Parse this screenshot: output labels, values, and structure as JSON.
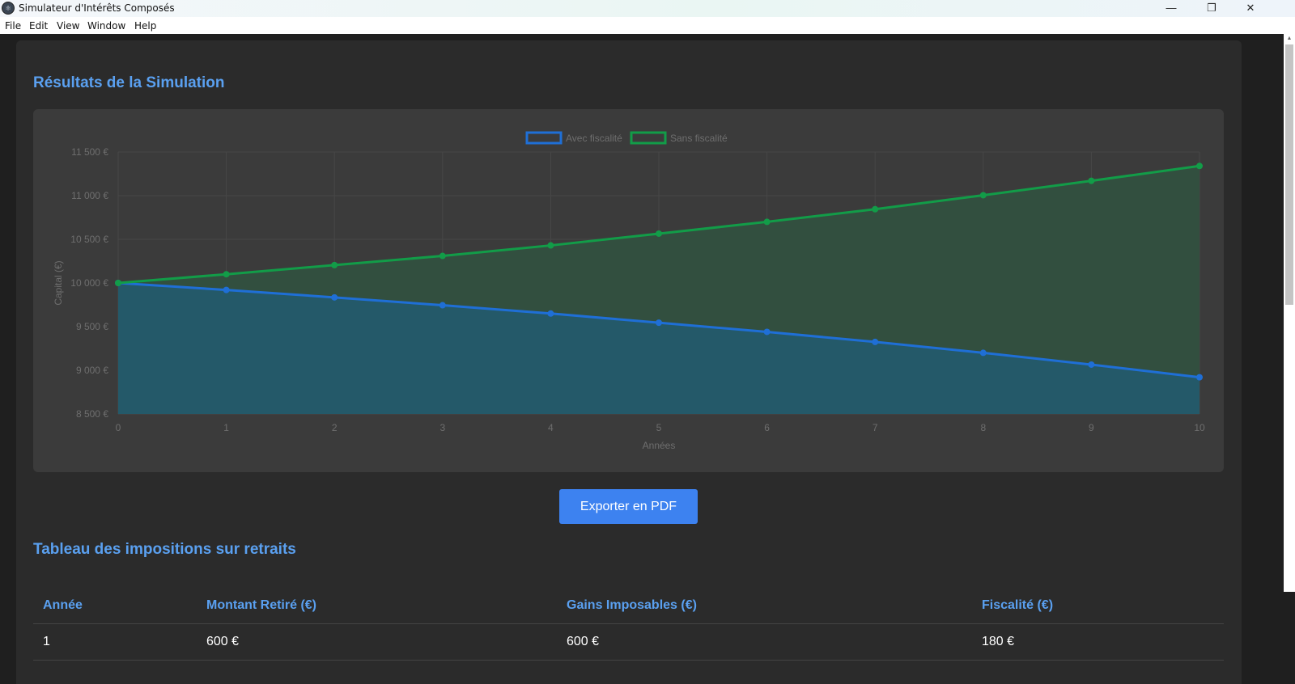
{
  "window": {
    "title": "Simulateur d'Intérêts Composés",
    "minimize": "—",
    "restore": "❐",
    "close": "✕"
  },
  "menu": [
    "File",
    "Edit",
    "View",
    "Window",
    "Help"
  ],
  "results": {
    "title": "Résultats de la Simulation",
    "export_label": "Exporter en PDF"
  },
  "chart_data": {
    "type": "line",
    "x": [
      0,
      1,
      2,
      3,
      4,
      5,
      6,
      7,
      8,
      9,
      10
    ],
    "xlabel": "Années",
    "ylabel": "Capital (€)",
    "ylim": [
      8500,
      11500
    ],
    "yticks": [
      "8 500 €",
      "9 000 €",
      "9 500 €",
      "10 000 €",
      "10 500 €",
      "11 000 €",
      "11 500 €"
    ],
    "ytick_values": [
      8500,
      9000,
      9500,
      10000,
      10500,
      11000,
      11500
    ],
    "grid": true,
    "legend_position": "top-center",
    "fill": true,
    "series": [
      {
        "name": "Avec fiscalité",
        "color": "#1f6fd6",
        "fill_color": "#245a6b",
        "values": [
          10000,
          9920,
          9835,
          9745,
          9650,
          9545,
          9440,
          9325,
          9200,
          9065,
          8920
        ]
      },
      {
        "name": "Sans fiscalité",
        "color": "#129c48",
        "fill_color": "#32503f",
        "values": [
          10000,
          10100,
          10205,
          10310,
          10430,
          10565,
          10700,
          10845,
          11005,
          11170,
          11340
        ]
      }
    ]
  },
  "taxes": {
    "title": "Tableau des impositions sur retraits",
    "columns": [
      "Année",
      "Montant Retiré (€)",
      "Gains Imposables (€)",
      "Fiscalité (€)"
    ],
    "rows": [
      [
        "1",
        "600 €",
        "600 €",
        "180 €"
      ]
    ]
  },
  "colors": {
    "accent": "#5aa0f0",
    "button": "#3d82f0",
    "panel": "#2b2b2b",
    "chart_bg": "#3b3b3b"
  }
}
